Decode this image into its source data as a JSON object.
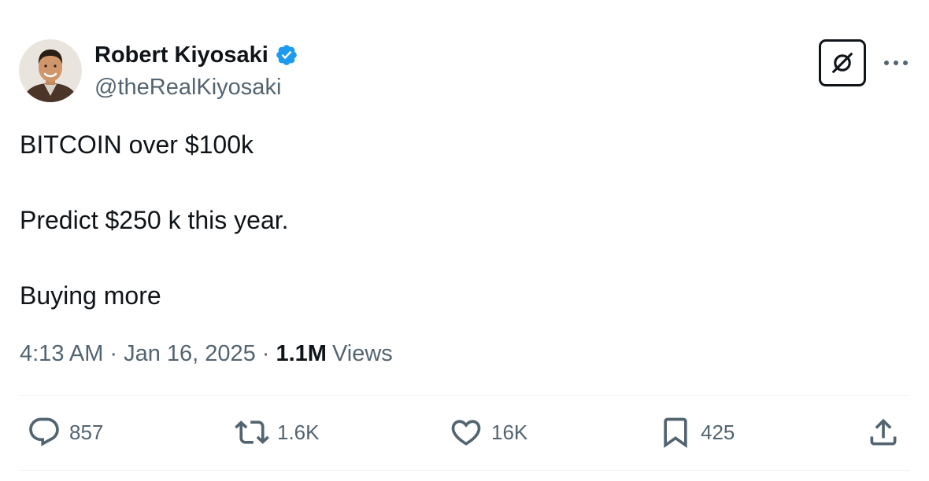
{
  "author": {
    "display_name": "Robert Kiyosaki",
    "handle": "@theRealKiyosaki",
    "verified_icon": "verified-badge-icon",
    "verified_color": "#1d9bf0"
  },
  "header_actions": {
    "grok_icon": "grok-icon",
    "more_icon": "more-horizontal-icon"
  },
  "tweet": {
    "lines": [
      "BITCOIN over $100k",
      "Predict $250 k this year.",
      "Buying more"
    ]
  },
  "meta": {
    "time": "4:13 AM",
    "separator": "·",
    "date": "Jan 16, 2025",
    "views_count": "1.1M",
    "views_label": "Views"
  },
  "actions": {
    "reply": {
      "icon": "reply-icon",
      "count": "857"
    },
    "repost": {
      "icon": "repost-icon",
      "count": "1.6K"
    },
    "like": {
      "icon": "heart-icon",
      "count": "16K"
    },
    "bookmark": {
      "icon": "bookmark-icon",
      "count": "425"
    },
    "share": {
      "icon": "share-icon"
    }
  },
  "colors": {
    "text_primary": "#0f1419",
    "text_secondary": "#536471",
    "divider": "#eff3f4"
  }
}
